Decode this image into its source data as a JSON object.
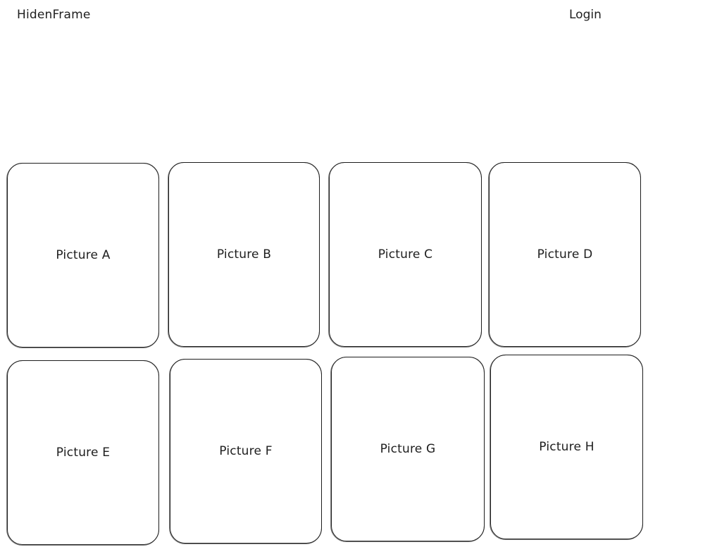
{
  "header": {
    "brand": "HidenFrame",
    "login_label": "Login"
  },
  "gallery": {
    "items": [
      {
        "label": "Picture A"
      },
      {
        "label": "Picture B"
      },
      {
        "label": "Picture C"
      },
      {
        "label": "Picture D"
      },
      {
        "label": "Picture E"
      },
      {
        "label": "Picture F"
      },
      {
        "label": "Picture G"
      },
      {
        "label": "Picture H"
      }
    ]
  }
}
